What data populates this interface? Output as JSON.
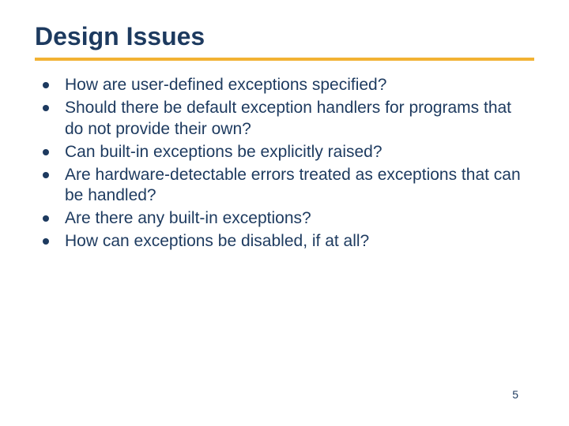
{
  "slide": {
    "title": "Design Issues",
    "bullets": [
      "How are user-defined exceptions specified?",
      "Should there be default exception handlers for programs that do not provide their own?",
      "Can built-in exceptions be explicitly raised?",
      "Are hardware-detectable errors treated as exceptions that can be handled?",
      "Are there any built-in exceptions?",
      "How can exceptions be disabled, if at all?"
    ],
    "page_number": "5"
  }
}
